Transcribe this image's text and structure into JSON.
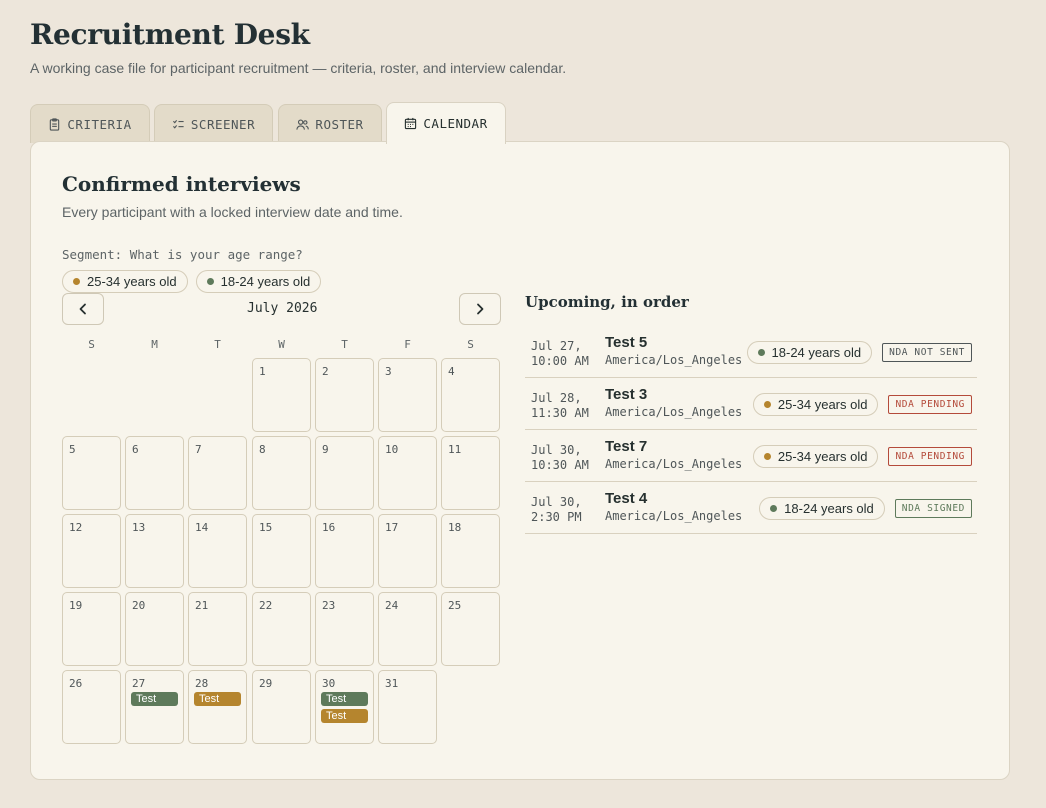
{
  "app": {
    "title": "Recruitment Desk",
    "subtitle": "A working case file for participant recruitment — criteria, roster, and interview calendar."
  },
  "tabs": [
    {
      "label": "CRITERIA",
      "icon": "clipboard-icon"
    },
    {
      "label": "SCREENER",
      "icon": "checklist-icon"
    },
    {
      "label": "ROSTER",
      "icon": "users-icon"
    },
    {
      "label": "CALENDAR",
      "icon": "calendar-icon",
      "active": true
    }
  ],
  "panel": {
    "title": "Confirmed interviews",
    "subtitle": "Every participant with a locked interview date and time."
  },
  "segment": {
    "label": "Segment: What is your age range?",
    "legend": [
      {
        "label": "25-34 years old",
        "color": "#b5852e"
      },
      {
        "label": "18-24 years old",
        "color": "#5e7a5b"
      }
    ]
  },
  "calendar": {
    "month_label": "July 2026",
    "weekdays": [
      "S",
      "M",
      "T",
      "W",
      "T",
      "F",
      "S"
    ],
    "first_weekday": 3,
    "days_in_month": 31,
    "events": {
      "27": [
        {
          "label": "Test",
          "color": "#5e7a5b"
        }
      ],
      "28": [
        {
          "label": "Test",
          "color": "#b5852e"
        }
      ],
      "30": [
        {
          "label": "Test",
          "color": "#5e7a5b"
        },
        {
          "label": "Test",
          "color": "#b5852e"
        }
      ]
    }
  },
  "upcoming": {
    "title": "Upcoming, in order",
    "items": [
      {
        "date": "Jul 27,",
        "time": "10:00 AM",
        "name": "Test 5",
        "tz": "America/Los_Angeles",
        "segment": "18-24 years old",
        "segment_color": "#5e7a5b",
        "nda": "NDA NOT SENT",
        "nda_color": "#4f5658"
      },
      {
        "date": "Jul 28,",
        "time": "11:30 AM",
        "name": "Test 3",
        "tz": "America/Los_Angeles",
        "segment": "25-34 years old",
        "segment_color": "#b5852e",
        "nda": "NDA PENDING",
        "nda_color": "#b44a3a"
      },
      {
        "date": "Jul 30,",
        "time": "10:30 AM",
        "name": "Test 7",
        "tz": "America/Los_Angeles",
        "segment": "25-34 years old",
        "segment_color": "#b5852e",
        "nda": "NDA PENDING",
        "nda_color": "#b44a3a"
      },
      {
        "date": "Jul 30,",
        "time": "2:30 PM",
        "name": "Test 4",
        "tz": "America/Los_Angeles",
        "segment": "18-24 years old",
        "segment_color": "#5e7a5b",
        "nda": "NDA SIGNED",
        "nda_color": "#5e7a5b"
      }
    ]
  }
}
